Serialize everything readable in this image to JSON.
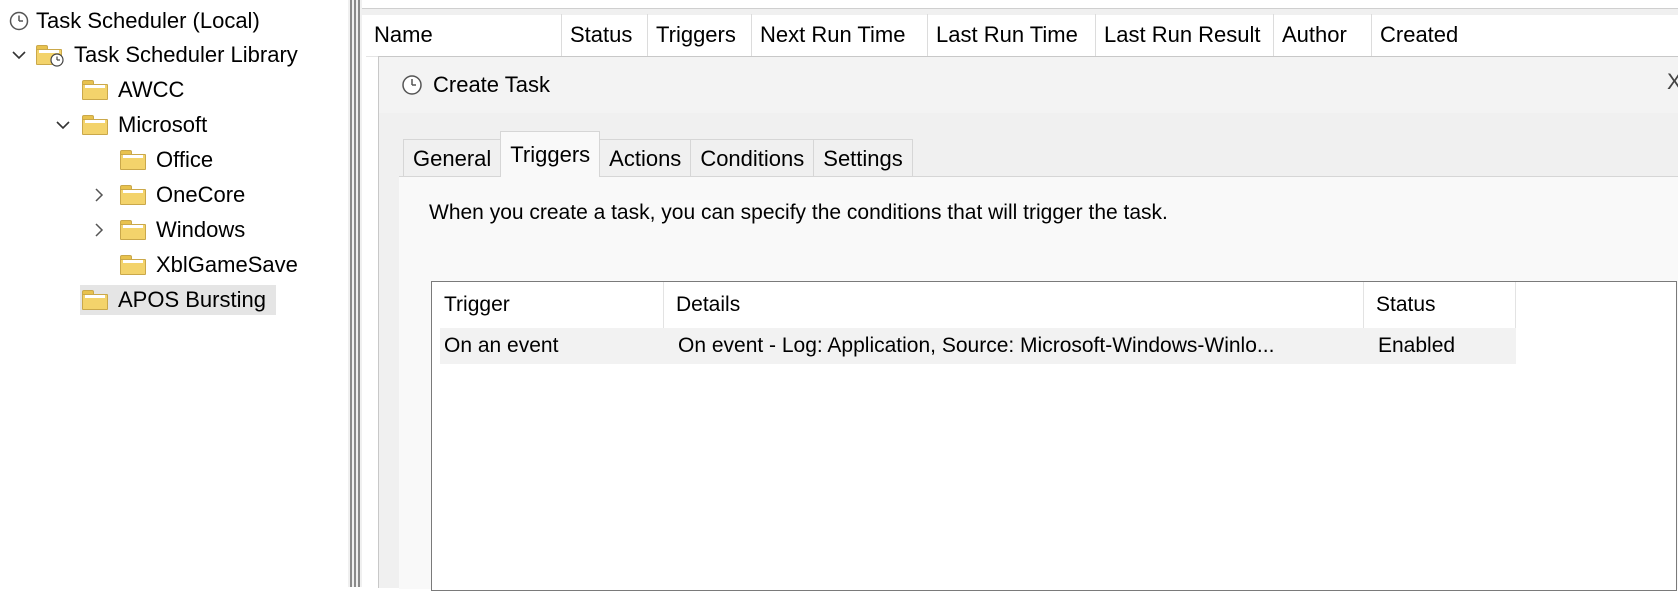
{
  "tree": {
    "root_label": "Task Scheduler (Local)",
    "library_label": "Task Scheduler Library",
    "items": [
      {
        "label": "AWCC"
      },
      {
        "label": "Microsoft"
      },
      {
        "label": "Office"
      },
      {
        "label": "OneCore"
      },
      {
        "label": "Windows"
      },
      {
        "label": "XblGameSave"
      },
      {
        "label": "APOS Bursting"
      }
    ]
  },
  "task_columns": [
    "Name",
    "Status",
    "Triggers",
    "Next Run Time",
    "Last Run Time",
    "Last Run Result",
    "Author",
    "Created"
  ],
  "dialog": {
    "title": "Create Task",
    "close_glyph": "X",
    "tabs": [
      "General",
      "Triggers",
      "Actions",
      "Conditions",
      "Settings"
    ],
    "active_tab": "Triggers",
    "description": "When you create a task, you can specify the conditions that will trigger the task.",
    "trigger_columns": [
      "Trigger",
      "Details",
      "Status"
    ],
    "triggers": [
      {
        "trigger": "On an event",
        "details": "On event - Log: Application, Source: Microsoft-Windows-Winlo...",
        "status": "Enabled"
      }
    ]
  },
  "icons": {
    "clock": "clock-icon",
    "task-library": "task-library-icon",
    "folder": "folder-icon",
    "chevron-down": "chevron-down-icon",
    "chevron-right": "chevron-right-icon"
  },
  "colors": {
    "folder": "#f3d36b",
    "selected_bg": "#e5e5e5",
    "dialog_bg": "#f0f0f0",
    "list_border": "#7a7a7a"
  }
}
